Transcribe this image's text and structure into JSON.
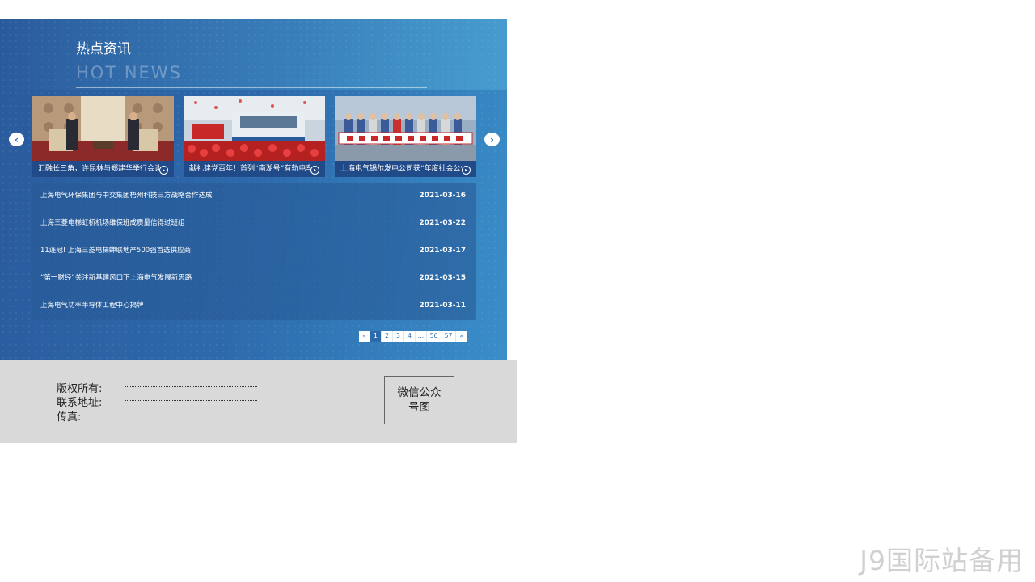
{
  "news": {
    "title_cn": "热点资讯",
    "title_en": "HOT NEWS",
    "prev_arrow": "‹",
    "next_arrow": "›",
    "cards": [
      {
        "caption": "汇融长三角，许昆林与郑建华举行会谈",
        "icon": "play-circle-icon"
      },
      {
        "caption": "献礼建党百年！首列“南湖号”有轨电车",
        "icon": "play-circle-icon"
      },
      {
        "caption": "上海电气锅尔发电公司获“年度社会公益",
        "icon": "play-circle-icon"
      }
    ],
    "items": [
      {
        "title": "上海电气环保集团与中交集团梧州科技三方战略合作达成",
        "date": "2021-03-16"
      },
      {
        "title": "上海三菱电梯虹桥机场维保班成质量信得过班组",
        "date": "2021-03-22"
      },
      {
        "title": "11连冠! 上海三菱电梯蝉联地产500强首选供应商",
        "date": "2021-03-17"
      },
      {
        "title": "“第一财经”关注新基建风口下上海电气发展新思路",
        "date": "2021-03-15"
      },
      {
        "title": "上海电气功率半导体工程中心揭牌",
        "date": "2021-03-11"
      }
    ],
    "pagination": {
      "prev": "«",
      "pages": [
        "1",
        "2",
        "3",
        "4",
        "...",
        "56",
        "57"
      ],
      "next": "»",
      "current": "1"
    }
  },
  "footer": {
    "copyright_label": "版权所有:",
    "address_label": "联系地址:",
    "fax_label": "传真:",
    "qr_text": "微信公众号图"
  },
  "watermark": "J9国际站备用",
  "colors": {
    "panel_blue": "#2d6aac",
    "footer_gray": "#d9d9d9"
  }
}
